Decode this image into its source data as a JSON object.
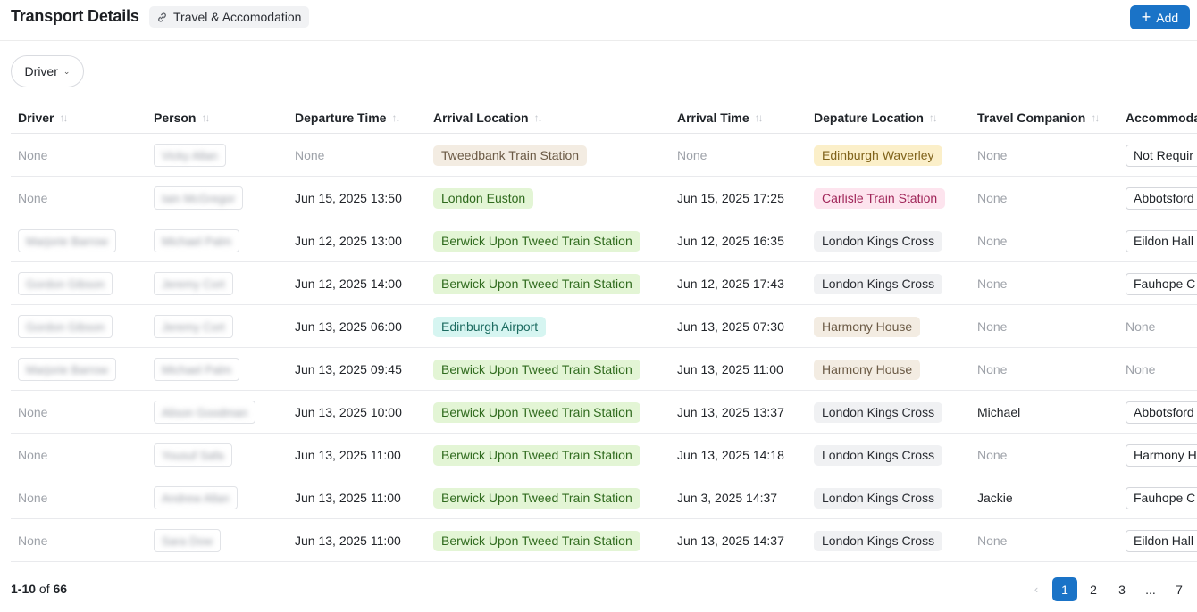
{
  "header": {
    "title": "Transport Details",
    "link_chip": "Travel & Accomodation",
    "add_button": "Add"
  },
  "filter": {
    "label": "Driver"
  },
  "columns": [
    "Driver",
    "Person",
    "Departure Time",
    "Arrival Location",
    "Arrival Time",
    "Depature Location",
    "Travel Companion",
    "Accommoda"
  ],
  "rows": [
    {
      "driver": "None",
      "person": "Vicky Allan",
      "departure_time": "None",
      "arrival_location": "Tweedbank Train Station",
      "arrival_time": "None",
      "departure_location": "Edinburgh Waverley",
      "companion": "None",
      "accommodation": "Not Requir"
    },
    {
      "driver": "None",
      "person": "Iain McGregor",
      "departure_time": "Jun 15, 2025 13:50",
      "arrival_location": "London Euston",
      "arrival_time": "Jun 15, 2025 17:25",
      "departure_location": "Carlisle Train Station",
      "companion": "None",
      "accommodation": "Abbotsford"
    },
    {
      "driver": "Marjorie Barrow",
      "person": "Michael Palm",
      "departure_time": "Jun 12, 2025 13:00",
      "arrival_location": "Berwick Upon Tweed Train Station",
      "arrival_time": "Jun 12, 2025 16:35",
      "departure_location": "London Kings Cross",
      "companion": "None",
      "accommodation": "Eildon Hall"
    },
    {
      "driver": "Gordon Gibson",
      "person": "Jeremy Cort",
      "departure_time": "Jun 12, 2025 14:00",
      "arrival_location": "Berwick Upon Tweed Train Station",
      "arrival_time": "Jun 12, 2025 17:43",
      "departure_location": "London Kings Cross",
      "companion": "None",
      "accommodation": "Fauhope C"
    },
    {
      "driver": "Gordon Gibson",
      "person": "Jeremy Cort",
      "departure_time": "Jun 13, 2025 06:00",
      "arrival_location": "Edinburgh Airport",
      "arrival_time": "Jun 13, 2025 07:30",
      "departure_location": "Harmony House",
      "companion": "None",
      "accommodation": "None"
    },
    {
      "driver": "Marjorie Barrow",
      "person": "Michael Palm",
      "departure_time": "Jun 13, 2025 09:45",
      "arrival_location": "Berwick Upon Tweed Train Station",
      "arrival_time": "Jun 13, 2025 11:00",
      "departure_location": "Harmony House",
      "companion": "None",
      "accommodation": "None"
    },
    {
      "driver": "None",
      "person": "Alison Goodman",
      "departure_time": "Jun 13, 2025 10:00",
      "arrival_location": "Berwick Upon Tweed Train Station",
      "arrival_time": "Jun 13, 2025 13:37",
      "departure_location": "London Kings Cross",
      "companion": "Michael",
      "accommodation": "Abbotsford"
    },
    {
      "driver": "None",
      "person": "Yousuf Safa",
      "departure_time": "Jun 13, 2025 11:00",
      "arrival_location": "Berwick Upon Tweed Train Station",
      "arrival_time": "Jun 13, 2025 14:18",
      "departure_location": "London Kings Cross",
      "companion": "None",
      "accommodation": "Harmony H"
    },
    {
      "driver": "None",
      "person": "Andrew Allan",
      "departure_time": "Jun 13, 2025 11:00",
      "arrival_location": "Berwick Upon Tweed Train Station",
      "arrival_time": "Jun 3, 2025 14:37",
      "departure_location": "London Kings Cross",
      "companion": "Jackie",
      "accommodation": "Fauhope C"
    },
    {
      "driver": "None",
      "person": "Sara Dow",
      "departure_time": "Jun 13, 2025 11:00",
      "arrival_location": "Berwick Upon Tweed Train Station",
      "arrival_time": "Jun 13, 2025 14:37",
      "departure_location": "London Kings Cross",
      "companion": "None",
      "accommodation": "Eildon Hall"
    }
  ],
  "footer": {
    "range": "1-10",
    "of_label": "of",
    "total": "66"
  },
  "pagination": {
    "prev": "‹",
    "pages": [
      "1",
      "2",
      "3",
      "...",
      "7"
    ],
    "current": "1"
  },
  "location_tag_colors": {
    "Tweedbank Train Station": "tan",
    "London Euston": "green",
    "Berwick Upon Tweed Train Station": "green",
    "Edinburgh Airport": "teal",
    "Edinburgh Waverley": "yellow",
    "Carlisle Train Station": "pink",
    "London Kings Cross": "gray",
    "Harmony House": "tan"
  },
  "colors": {
    "accent": "#1a73c7",
    "muted_text": "#9ea2a9"
  }
}
